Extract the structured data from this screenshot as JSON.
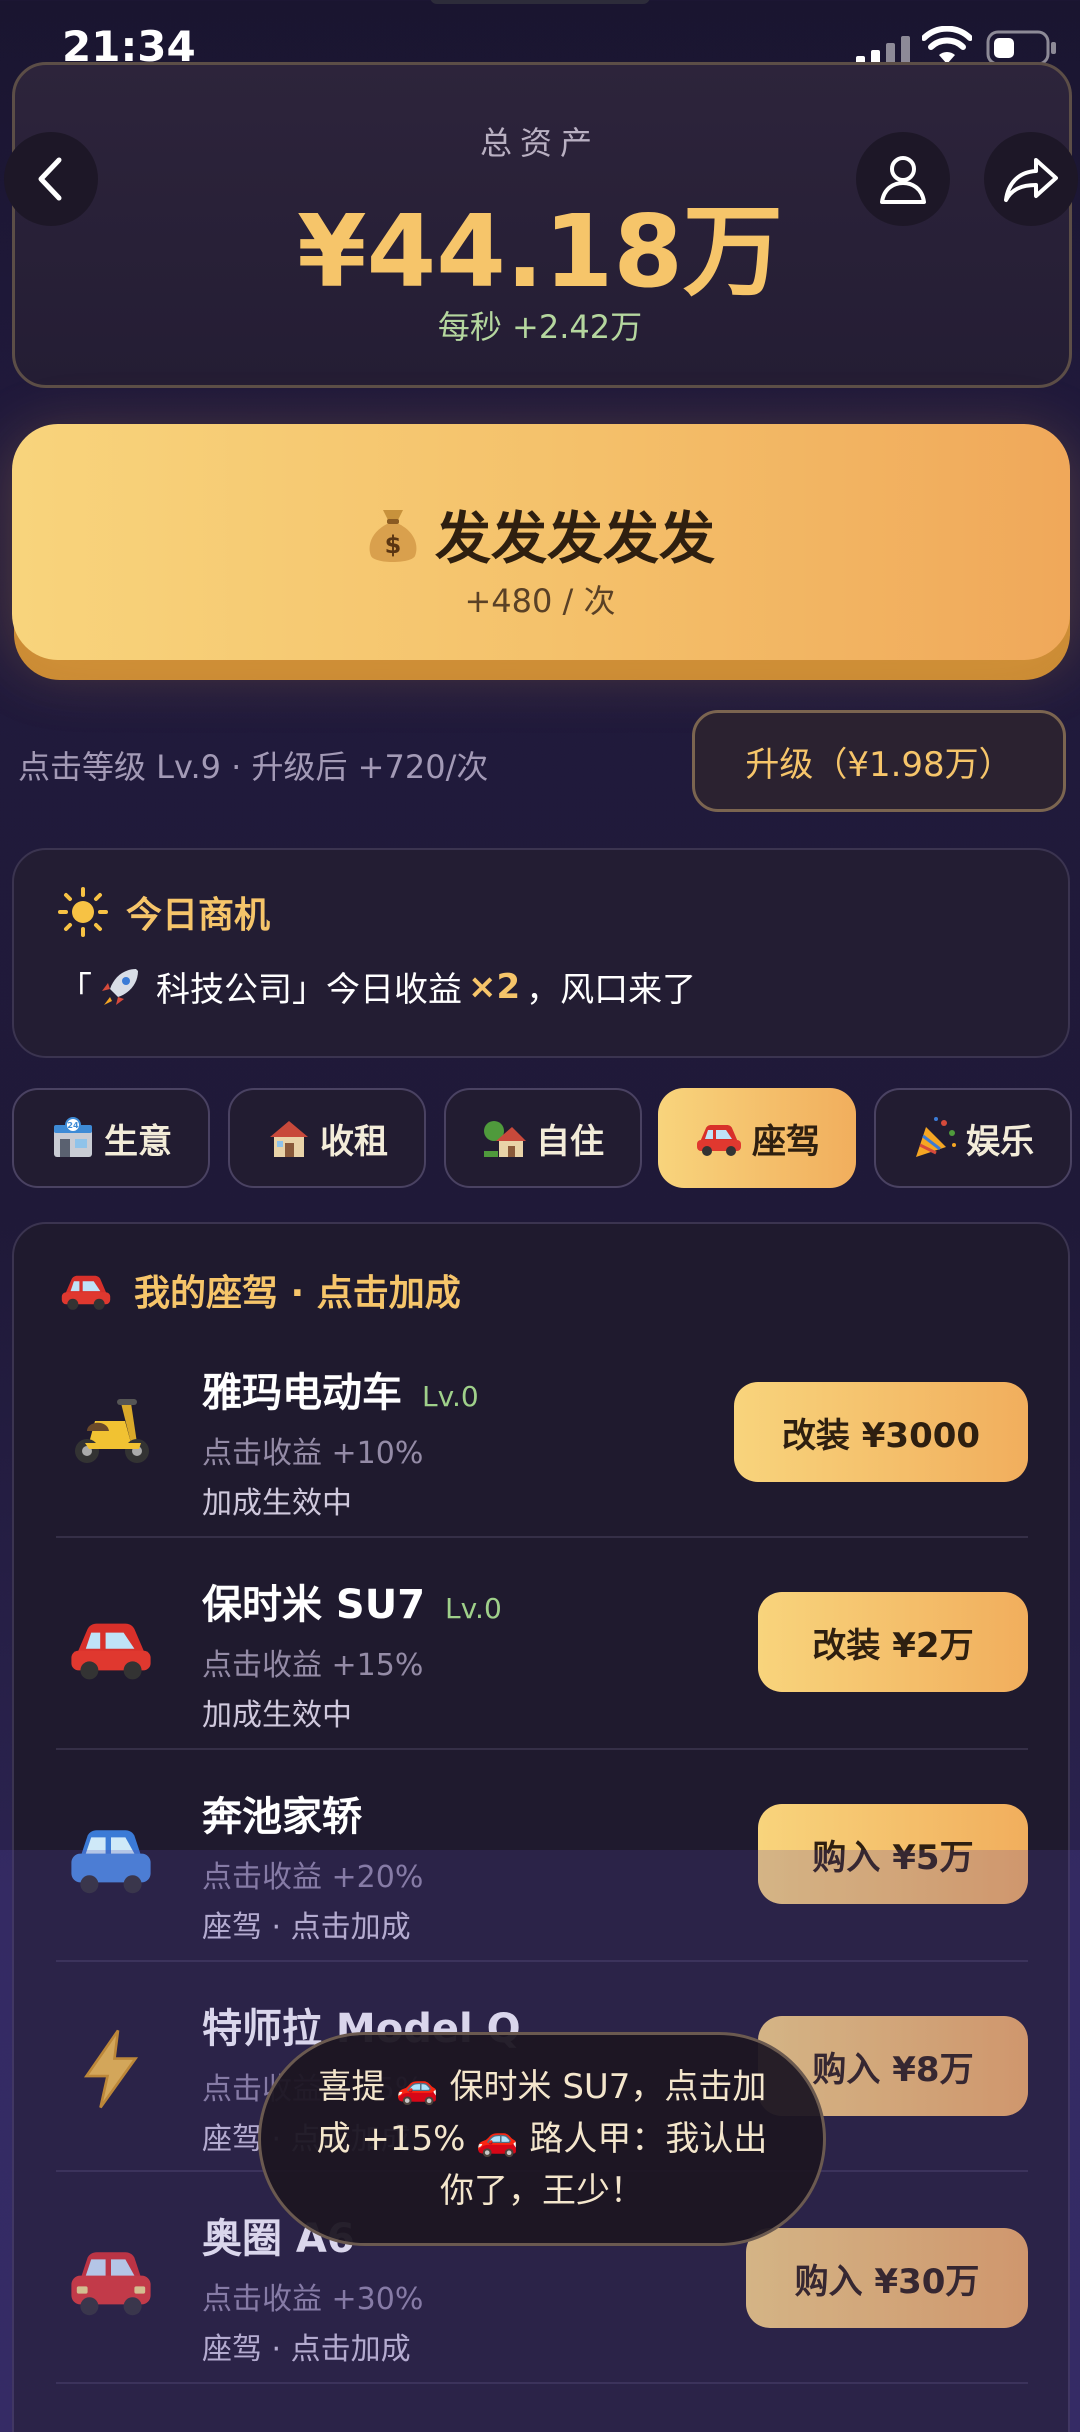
{
  "status_bar": {
    "time": "21:34"
  },
  "header": {
    "total_label": "总资产",
    "total_value": "¥44.18万",
    "per_second": "每秒 +2.42万"
  },
  "tap_button": {
    "title": "发发发发发",
    "sub": "+480 / 次"
  },
  "click_info": {
    "level_text": "点击等级 Lv.9 · 升级后 +720/次",
    "upgrade_label": "升级（¥1.98万）"
  },
  "opportunity": {
    "title": "今日商机",
    "prefix": "「",
    "company": "科技公司」今日收益",
    "multiplier": "×2",
    "suffix": "，风口来了"
  },
  "tabs": [
    {
      "label": "生意",
      "active": false
    },
    {
      "label": "收租",
      "active": false
    },
    {
      "label": "自住",
      "active": false
    },
    {
      "label": "座驾",
      "active": true
    },
    {
      "label": "娱乐",
      "active": false
    }
  ],
  "list": {
    "title": "我的座驾 · 点击加成",
    "items": [
      {
        "name": "雅玛电动车",
        "level": "Lv.0",
        "bonus": "点击收益 +10%",
        "status": "加成生效中",
        "button": "改装 ¥3000",
        "icon": "scooter-icon"
      },
      {
        "name": "保时米 SU7",
        "level": "Lv.0",
        "bonus": "点击收益 +15%",
        "status": "加成生效中",
        "button": "改装 ¥2万",
        "icon": "red-car-icon"
      },
      {
        "name": "奔池家轿",
        "level": "",
        "bonus": "点击收益 +20%",
        "status": "座驾 · 点击加成",
        "button": "购入 ¥5万",
        "icon": "blue-car-icon"
      },
      {
        "name": "特师拉 Model Q",
        "level": "",
        "bonus": "点击收益 +25%",
        "status": "座驾 · 点击加成",
        "button": "购入 ¥8万",
        "icon": "lightning-icon"
      },
      {
        "name": "奥圈 A6",
        "level": "",
        "bonus": "点击收益 +30%",
        "status": "座驾 · 点击加成",
        "button": "购入 ¥30万",
        "icon": "sedan-icon"
      }
    ]
  },
  "toast": {
    "text": "喜提 🚗 保时米 SU7，点击加成 +15% 🚗 路人甲：我认出你了，王少！"
  },
  "colors": {
    "gold": "#f6c56a",
    "green": "#9fd08a",
    "background": "#1f1938"
  }
}
